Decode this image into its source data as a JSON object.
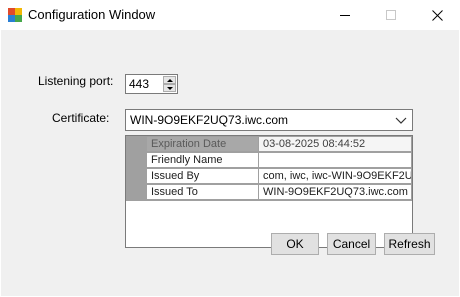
{
  "window": {
    "title": "Configuration Window"
  },
  "listening_port": {
    "label": "Listening port:",
    "value": "443"
  },
  "certificate": {
    "label": "Certificate:",
    "selected": "WIN-9O9EKF2UQ73.iwc.com"
  },
  "cert_details": {
    "rows": [
      {
        "key": "Expiration Date",
        "value": "03-08-2025 08:44:52"
      },
      {
        "key": "Friendly Name",
        "value": ""
      },
      {
        "key": "Issued By",
        "value": "com, iwc, iwc-WIN-9O9EKF2U"
      },
      {
        "key": "Issued To",
        "value": "WIN-9O9EKF2UQ73.iwc.com"
      }
    ]
  },
  "buttons": {
    "ok": "OK",
    "cancel": "Cancel",
    "refresh": "Refresh"
  },
  "colors": {
    "client_bg": "#f0f0f0",
    "grid_header": "#a0a0a0",
    "button_bg": "#e1e1e1"
  }
}
